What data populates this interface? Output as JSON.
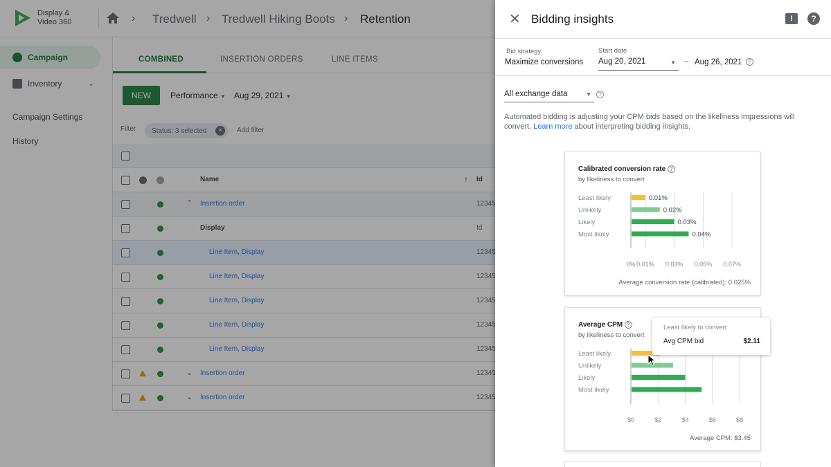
{
  "app": {
    "logo_line1": "Display &",
    "logo_line2": "Video 360",
    "breadcrumbs": [
      "Tredwell",
      "Tredwell Hiking Boots",
      "Retention"
    ]
  },
  "sidebar": {
    "items": [
      {
        "label": "Campaign"
      },
      {
        "label": "Inventory"
      },
      {
        "label": "Campaign Settings"
      },
      {
        "label": "History"
      }
    ]
  },
  "main": {
    "tabs": [
      "COMBINED",
      "INSERTION ORDERS",
      "LINE ITEMS"
    ],
    "new_label": "NEW",
    "performance_label": "Performance",
    "date_label": "Aug 29, 2021",
    "filter_label": "Filter",
    "status_chip": "Status: 3 selected",
    "add_filter": "Add filter",
    "columns": {
      "name": "Name",
      "id": "Id"
    },
    "rows": [
      {
        "name": "Insertion order",
        "id": "12345",
        "kind": "io",
        "warn": false,
        "caret": "^"
      },
      {
        "name": "Display",
        "id": "Id",
        "kind": "group",
        "warn": false,
        "caret": ""
      },
      {
        "name": "Line Item, Display",
        "id": "12345",
        "kind": "li",
        "warn": false,
        "caret": "",
        "selected": true
      },
      {
        "name": "Line Item, Display",
        "id": "12345",
        "kind": "li",
        "warn": false,
        "caret": ""
      },
      {
        "name": "Line Item, Display",
        "id": "12345",
        "kind": "li",
        "warn": false,
        "caret": ""
      },
      {
        "name": "Line Item, Display",
        "id": "12345",
        "kind": "li",
        "warn": false,
        "caret": ""
      },
      {
        "name": "Line Item, Display",
        "id": "12345",
        "kind": "li",
        "warn": false,
        "caret": ""
      },
      {
        "name": "Insertion order",
        "id": "12345",
        "kind": "io",
        "warn": true,
        "caret": "v"
      },
      {
        "name": "Insertion order",
        "id": "12345",
        "kind": "io",
        "warn": true,
        "caret": "v"
      }
    ]
  },
  "panel": {
    "title": "Bidding insights",
    "bid_strategy_label": "Bid strategy",
    "bid_strategy_value": "Maximize conversions",
    "start_date_label": "Start date",
    "start_date_value": "Aug 20, 2021",
    "end_date_value": "Aug 26, 2021",
    "date_sep": "–",
    "exchange_value": "All exchange data",
    "desc_pre": "Automated bidding is adjusting your CPM bids based on the likeliness impressions will convert. ",
    "desc_link": "Learn more",
    "desc_post": " about interpreting bidding insights."
  },
  "colors": {
    "least": "#f2bf42",
    "unlikely": "#81c995",
    "likely": "#34a853",
    "most": "#34a853",
    "accent": "#188038"
  },
  "chart_data": [
    {
      "type": "bar",
      "orientation": "horizontal",
      "title": "Calibrated conversion rate",
      "subtitle": "by likeliness to convert",
      "categories": [
        "Least likely",
        "Unlikely",
        "Likely",
        "Most likely"
      ],
      "values": [
        0.01,
        0.02,
        0.03,
        0.04
      ],
      "data_labels": [
        "0.01%",
        "0.02%",
        "0.03%",
        "0.04%"
      ],
      "ticks": [
        0,
        0.01,
        0.03,
        0.05,
        0.07
      ],
      "tick_labels": [
        "0%",
        "0.01%",
        "0.03%",
        "0.05%",
        "0.07%"
      ],
      "xlim": [
        0,
        0.08
      ],
      "footer": "Average conversion rate (calibrated): 0.025%"
    },
    {
      "type": "bar",
      "orientation": "horizontal",
      "title": "Average CPM",
      "subtitle": "by likeliness to convert",
      "categories": [
        "Least likely",
        "Unlikely",
        "Likely",
        "Most likely"
      ],
      "values": [
        2.11,
        3.1,
        4.0,
        5.2
      ],
      "ticks": [
        0,
        2,
        4,
        6,
        8
      ],
      "tick_labels": [
        "$0",
        "$2",
        "$4",
        "$6",
        "$8"
      ],
      "xlim": [
        0,
        8.5
      ],
      "footer": "Average CPM: $3.45",
      "tooltip": {
        "title": "Least likely to convert",
        "label": "Avg CPM bid",
        "value": "$2.11"
      }
    }
  ]
}
